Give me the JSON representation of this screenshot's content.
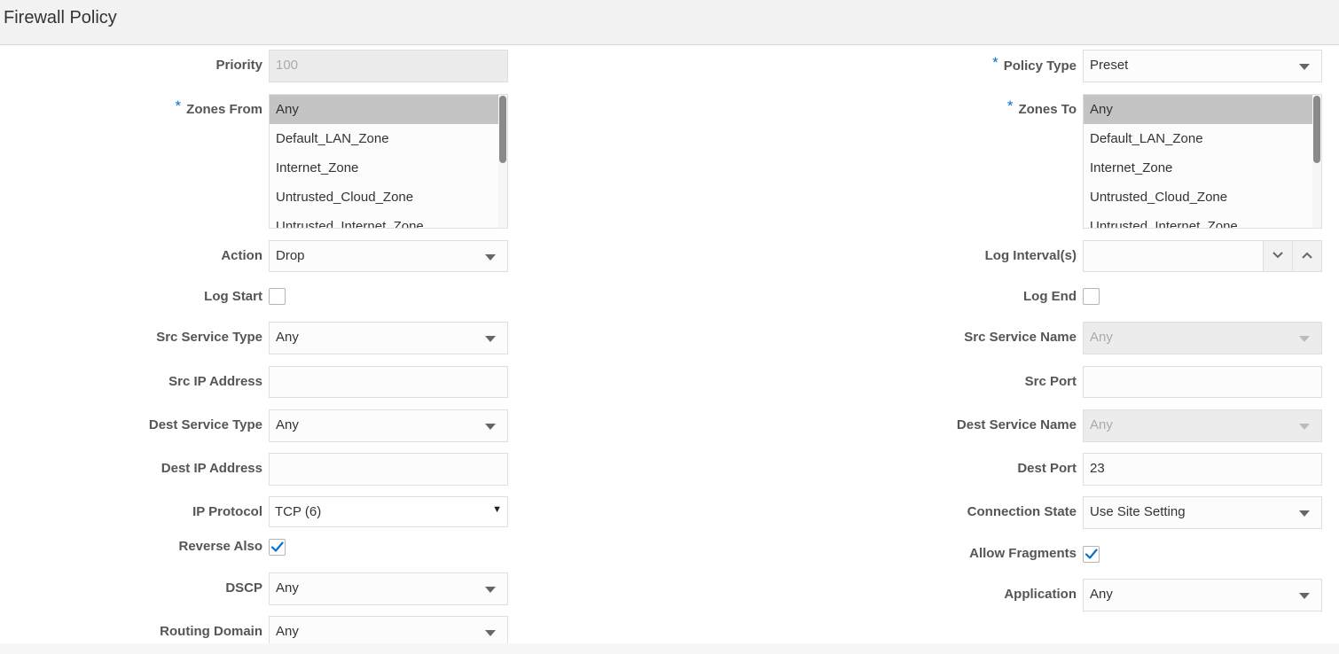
{
  "header": {
    "title": "Firewall Policy"
  },
  "form": {
    "priority": {
      "label": "Priority",
      "value": "100"
    },
    "policy_type": {
      "label": "Policy Type",
      "value": "Preset"
    },
    "zones_from": {
      "label": "Zones From",
      "options": [
        "Any",
        "Default_LAN_Zone",
        "Internet_Zone",
        "Untrusted_Cloud_Zone",
        "Untrusted_Internet_Zone"
      ],
      "selected": "Any"
    },
    "zones_to": {
      "label": "Zones To",
      "options": [
        "Any",
        "Default_LAN_Zone",
        "Internet_Zone",
        "Untrusted_Cloud_Zone",
        "Untrusted_Internet_Zone"
      ],
      "selected": "Any"
    },
    "action": {
      "label": "Action",
      "value": "Drop"
    },
    "log_interval": {
      "label": "Log Interval(s)",
      "value": ""
    },
    "log_start": {
      "label": "Log Start",
      "checked": false
    },
    "log_end": {
      "label": "Log End",
      "checked": false
    },
    "src_service_type": {
      "label": "Src Service Type",
      "value": "Any"
    },
    "src_service_name": {
      "label": "Src Service Name",
      "value": "Any"
    },
    "src_ip_address": {
      "label": "Src IP Address",
      "value": ""
    },
    "src_port": {
      "label": "Src Port",
      "value": ""
    },
    "dest_service_type": {
      "label": "Dest Service Type",
      "value": "Any"
    },
    "dest_service_name": {
      "label": "Dest Service Name",
      "value": "Any"
    },
    "dest_ip_address": {
      "label": "Dest IP Address",
      "value": ""
    },
    "dest_port": {
      "label": "Dest Port",
      "value": "23"
    },
    "ip_protocol": {
      "label": "IP Protocol",
      "value": "TCP (6)"
    },
    "connection_state": {
      "label": "Connection State",
      "value": "Use Site Setting"
    },
    "reverse_also": {
      "label": "Reverse Also",
      "checked": true
    },
    "allow_fragments": {
      "label": "Allow Fragments",
      "checked": true
    },
    "dscp": {
      "label": "DSCP",
      "value": "Any"
    },
    "application": {
      "label": "Application",
      "value": "Any"
    },
    "routing_domain": {
      "label": "Routing Domain",
      "value": "Any"
    },
    "required_marker": "*"
  },
  "colors": {
    "accent": "#0572ce",
    "selected_option": "#c4c4c4",
    "disabled_field": "#ececec"
  }
}
